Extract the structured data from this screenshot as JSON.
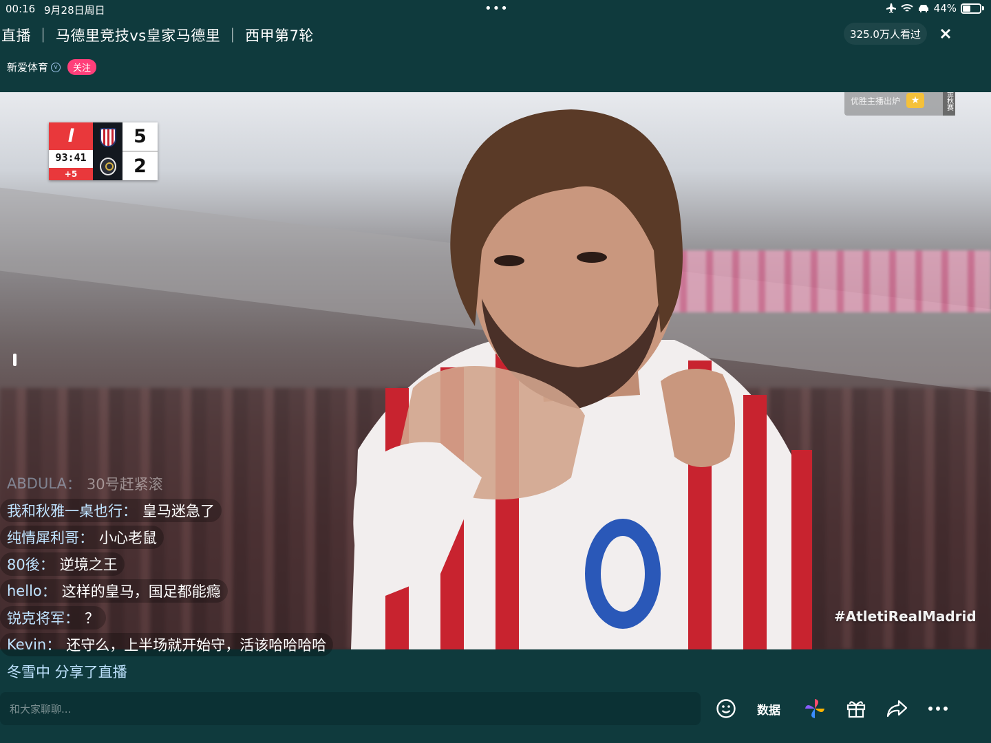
{
  "status_bar": {
    "time": "00:16",
    "date": "9月28日周日",
    "more_dots": "•••",
    "battery": "44%",
    "battery_level": 0.44
  },
  "header": {
    "title": "直播 ｜ 马德里竞技vs皇家马德里 ｜ 西甲第7轮",
    "viewers": "325.0万人看过",
    "channel_name": "新爱体育",
    "follow_label": "关注"
  },
  "video": {
    "scoreboard": {
      "clock": "93:41",
      "added_time": "+5",
      "home_score": "5",
      "away_score": "2"
    },
    "promo_text": "优胜主播出炉",
    "promo_tag": "金秋赛",
    "hashtag": "#AtletiRealMadrid"
  },
  "chat": [
    {
      "user": "ABDULA",
      "sep": "：",
      "msg": "30号赶紧滚",
      "faded": true
    },
    {
      "user": "我和秋雅一桌也行",
      "sep": "：",
      "msg": "皇马迷急了",
      "faded": false
    },
    {
      "user": "纯情犀利哥",
      "sep": "：",
      "msg": "小心老鼠",
      "faded": false
    },
    {
      "user": "80後",
      "sep": "：",
      "msg": "逆境之王",
      "faded": false
    },
    {
      "user": "hello",
      "sep": "：",
      "msg": "这样的皇马，国足都能瘾",
      "faded": false
    },
    {
      "user": "锐克将军",
      "sep": "：",
      "msg": "？",
      "faded": false
    },
    {
      "user": "Kevin",
      "sep": "：",
      "msg": "还守么，上半场就开始守，活该哈哈哈哈",
      "faded": false
    }
  ],
  "share_notice": "冬雪中 分享了直播",
  "bottom_bar": {
    "input_placeholder": "和大家聊聊...",
    "data_label": "数据",
    "icons": [
      "emoji-icon",
      "pinwheel-icon",
      "gift-icon",
      "share-icon",
      "more-icon"
    ]
  },
  "colors": {
    "background": "#0f3a3d",
    "follow": "#ff3f7a",
    "chat_username": "#bfe3ff",
    "scoreboard_red": "#e9383b"
  }
}
